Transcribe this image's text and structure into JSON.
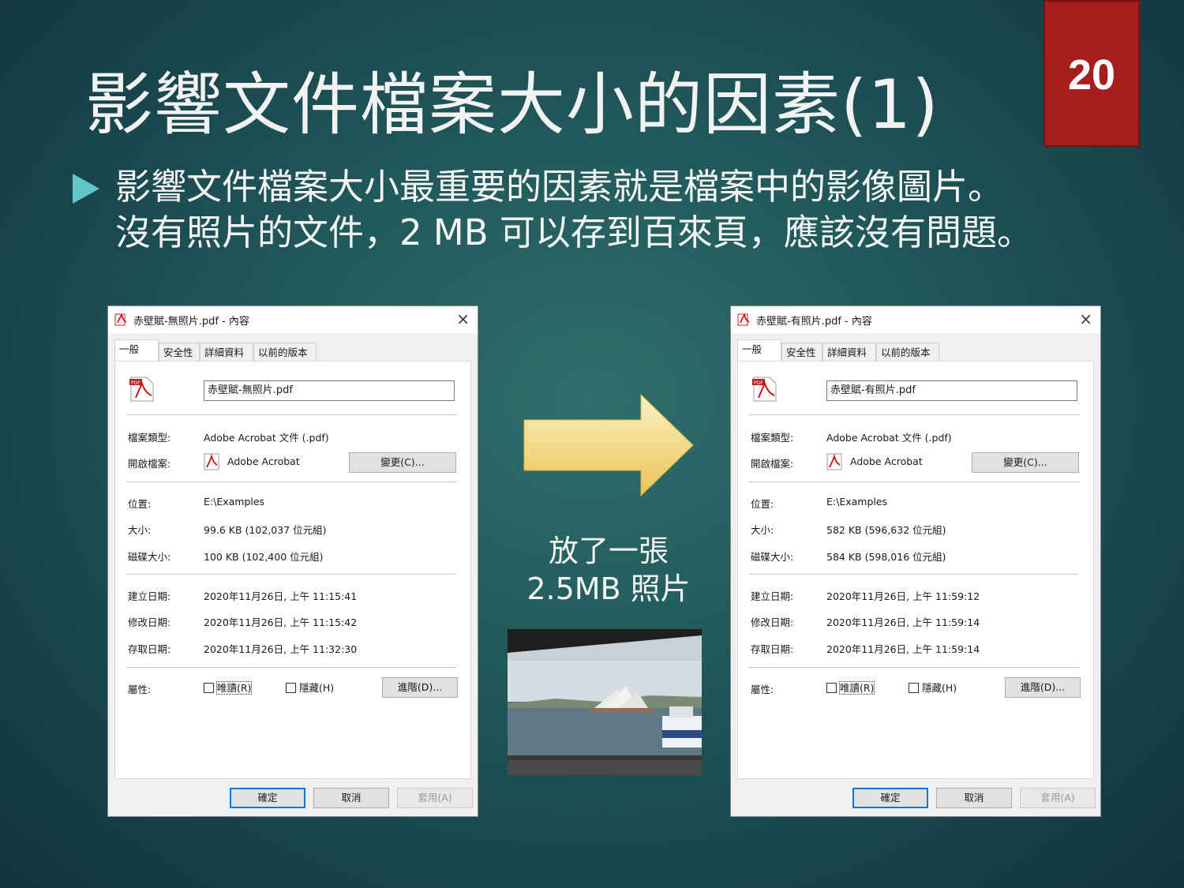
{
  "slide": {
    "title": "影響文件檔案大小的因素(1)",
    "page_number": "20",
    "bullet_lines": [
      "影響文件檔案大小最重要的因素就是檔案中的影像圖片。",
      "沒有照片的文件，2 MB 可以存到百來頁，應該沒有問題。"
    ],
    "caption_lines": [
      "放了一張",
      "2.5MB 照片"
    ]
  },
  "colors": {
    "badge": "#a51d1d",
    "bullet_marker": "#5fc6c9",
    "arrow_fill": "#f2d98a",
    "accent_button": "#0078d7"
  },
  "dialogs": [
    {
      "window_title": "赤壁賦-無照片.pdf - 內容",
      "close_label": "×",
      "tabs": [
        "一般",
        "安全性",
        "詳細資料",
        "以前的版本"
      ],
      "filename": "赤壁賦-無照片.pdf",
      "fields": {
        "type_label": "檔案類型:",
        "type_value": "Adobe Acrobat 文件 (.pdf)",
        "open_label": "開啟檔案:",
        "open_value": "Adobe Acrobat",
        "change_button": "變更(C)...",
        "location_label": "位置:",
        "location_value": "E:\\Examples",
        "size_label": "大小:",
        "size_value": "99.6 KB (102,037 位元組)",
        "disk_label": "磁碟大小:",
        "disk_value": "100 KB (102,400 位元組)",
        "created_label": "建立日期:",
        "created_value": "2020年11月26日, 上午 11:15:41",
        "modified_label": "修改日期:",
        "modified_value": "2020年11月26日, 上午 11:15:42",
        "accessed_label": "存取日期:",
        "accessed_value": "2020年11月26日, 上午 11:32:30",
        "attr_label": "屬性:",
        "readonly_label": "唯讀(R)",
        "hidden_label": "隱藏(H)",
        "advanced_button": "進階(D)..."
      },
      "ok_button": "確定",
      "cancel_button": "取消",
      "apply_button": "套用(A)"
    },
    {
      "window_title": "赤壁賦-有照片.pdf - 內容",
      "close_label": "×",
      "tabs": [
        "一般",
        "安全性",
        "詳細資料",
        "以前的版本"
      ],
      "filename": "赤壁賦-有照片.pdf",
      "fields": {
        "type_label": "檔案類型:",
        "type_value": "Adobe Acrobat 文件 (.pdf)",
        "open_label": "開啟檔案:",
        "open_value": "Adobe Acrobat",
        "change_button": "變更(C)...",
        "location_label": "位置:",
        "location_value": "E:\\Examples",
        "size_label": "大小:",
        "size_value": "582 KB (596,632 位元組)",
        "disk_label": "磁碟大小:",
        "disk_value": "584 KB (598,016 位元組)",
        "created_label": "建立日期:",
        "created_value": "2020年11月26日, 上午 11:59:12",
        "modified_label": "修改日期:",
        "modified_value": "2020年11月26日, 上午 11:59:14",
        "accessed_label": "存取日期:",
        "accessed_value": "2020年11月26日, 上午 11:59:14",
        "attr_label": "屬性:",
        "readonly_label": "唯讀(R)",
        "hidden_label": "隱藏(H)",
        "advanced_button": "進階(D)..."
      },
      "ok_button": "確定",
      "cancel_button": "取消",
      "apply_button": "套用(A)"
    }
  ]
}
